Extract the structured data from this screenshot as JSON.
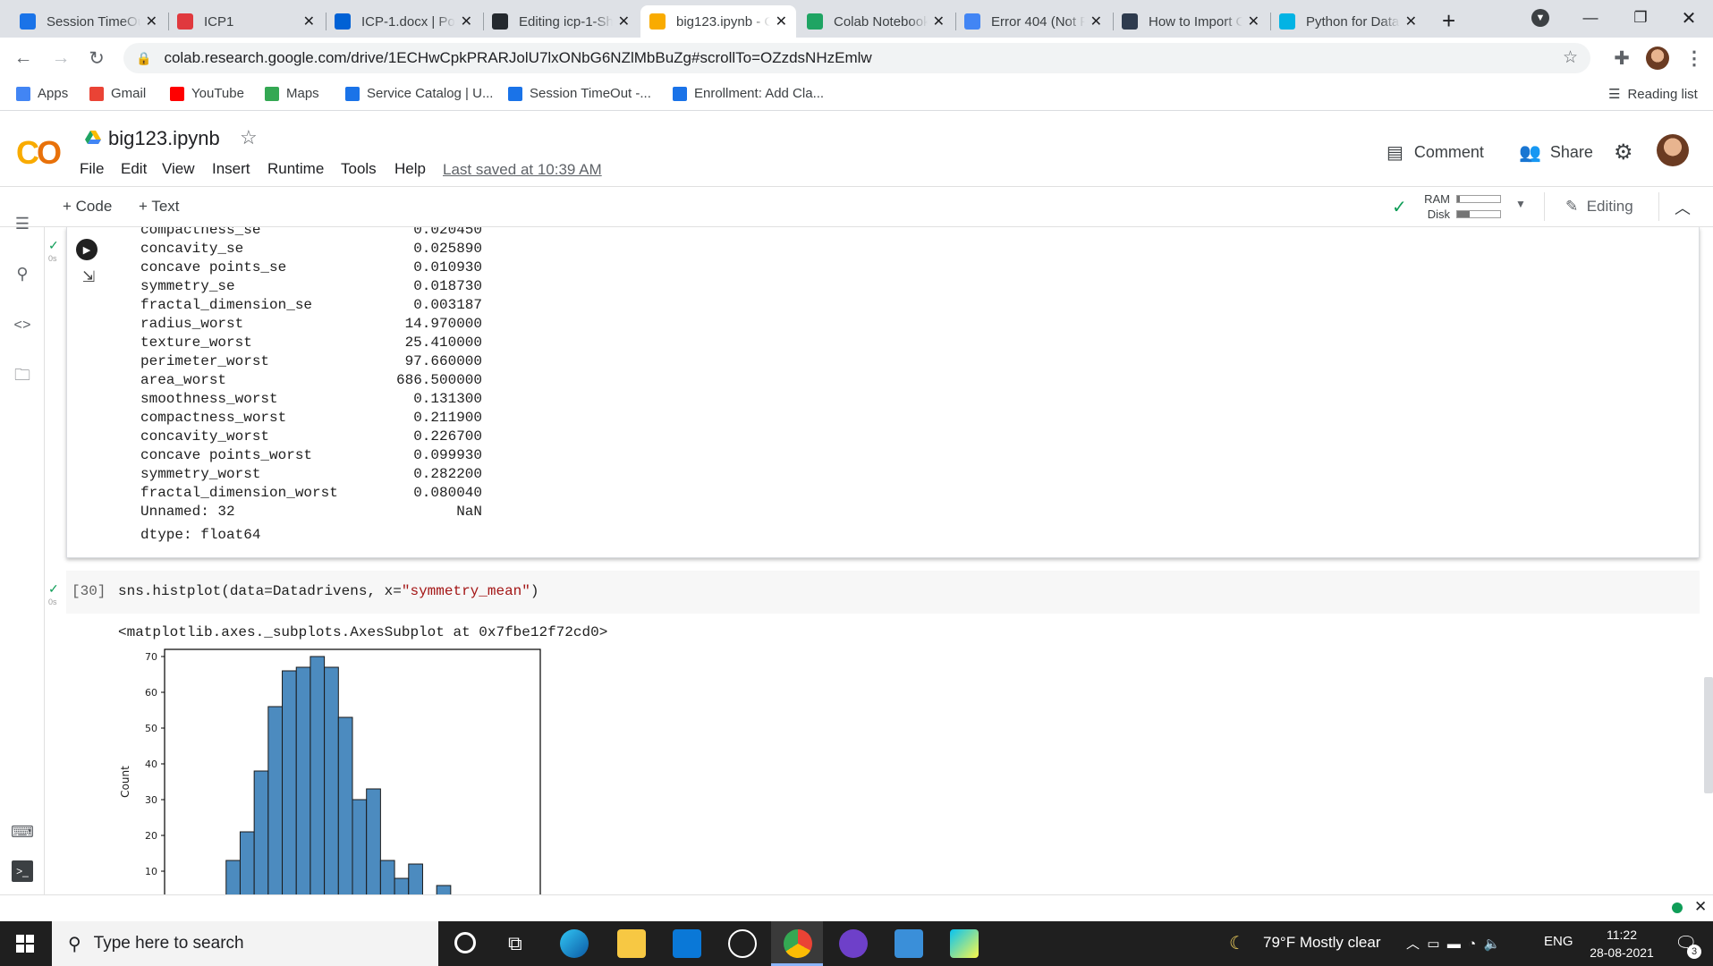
{
  "browser": {
    "tabs": [
      {
        "title": "Session TimeOut",
        "favicon": "salesforce-icon",
        "color": "#1a73e8"
      },
      {
        "title": "ICP1",
        "favicon": "canvas-icon",
        "color": "#e0393e"
      },
      {
        "title": "ICP-1.docx | Powered by Box",
        "favicon": "box-icon",
        "color": "#0061d5"
      },
      {
        "title": "Editing icp-1-Sheet",
        "favicon": "github-icon",
        "color": "#24292e"
      },
      {
        "title": "big123.ipynb - Colaboratory",
        "favicon": "colab-icon",
        "color": "#f9ab00"
      },
      {
        "title": "Colab Notebooks",
        "favicon": "drive-icon",
        "color": "#1fa463"
      },
      {
        "title": "Error 404 (Not Found)",
        "favicon": "google-icon",
        "color": "#4285f4"
      },
      {
        "title": "How to Import CSV",
        "favicon": "tds-icon",
        "color": "#2e3b4e"
      },
      {
        "title": "Python for Data Science",
        "favicon": "udacity-icon",
        "color": "#02b3e4"
      }
    ],
    "close_glyph": "✕",
    "new_tab_glyph": "+",
    "url": "colab.research.google.com/drive/1ECHwCpkPRARJolU7lxONbG6NZlMbBuZg#scrollTo=OZzdsNHzEmlw",
    "bookmarks": [
      {
        "label": "Apps",
        "icon": "apps-grid-icon",
        "color": "#4285f4"
      },
      {
        "label": "Gmail",
        "icon": "gmail-icon",
        "color": "#ea4335"
      },
      {
        "label": "YouTube",
        "icon": "youtube-icon",
        "color": "#ff0000"
      },
      {
        "label": "Maps",
        "icon": "maps-icon",
        "color": "#34a853"
      },
      {
        "label": "Service Catalog | U...",
        "icon": "service-icon",
        "color": "#1a73e8"
      },
      {
        "label": "Session TimeOut -...",
        "icon": "salesforce-icon",
        "color": "#1a73e8"
      },
      {
        "label": "Enrollment: Add Cla...",
        "icon": "salesforce-icon",
        "color": "#1a73e8"
      }
    ],
    "reading_list": "Reading list"
  },
  "colab": {
    "notebook_name": "big123.ipynb",
    "menu": [
      "File",
      "Edit",
      "View",
      "Insert",
      "Runtime",
      "Tools",
      "Help"
    ],
    "last_saved": "Last saved at 10:39 AM",
    "comment": "Comment",
    "share": "Share",
    "add_code": "+ Code",
    "add_text": "+ Text",
    "ram": "RAM",
    "disk": "Disk",
    "ram_fill": 0.06,
    "disk_fill": 0.3,
    "editing": "Editing",
    "accent": "#f9ab00"
  },
  "output_cell": {
    "exec_time": "0s",
    "rows": [
      {
        "key": "compactness_se",
        "value": "0.020450"
      },
      {
        "key": "concavity_se",
        "value": "0.025890"
      },
      {
        "key": "concave points_se",
        "value": "0.010930"
      },
      {
        "key": "symmetry_se",
        "value": "0.018730"
      },
      {
        "key": "fractal_dimension_se",
        "value": "0.003187"
      },
      {
        "key": "radius_worst",
        "value": "14.970000"
      },
      {
        "key": "texture_worst",
        "value": "25.410000"
      },
      {
        "key": "perimeter_worst",
        "value": "97.660000"
      },
      {
        "key": "area_worst",
        "value": "686.500000"
      },
      {
        "key": "smoothness_worst",
        "value": "0.131300"
      },
      {
        "key": "compactness_worst",
        "value": "0.211900"
      },
      {
        "key": "concavity_worst",
        "value": "0.226700"
      },
      {
        "key": "concave points_worst",
        "value": "0.099930"
      },
      {
        "key": "symmetry_worst",
        "value": "0.282200"
      },
      {
        "key": "fractal_dimension_worst",
        "value": "0.080040"
      },
      {
        "key": "Unnamed: 32",
        "value": "NaN"
      }
    ],
    "dtype": "dtype: float64"
  },
  "code_cell": {
    "exec_count": "[30]",
    "exec_time": "0s",
    "code_prefix": "sns.histplot(data=Datadrivens, x=",
    "code_string": "\"symmetry_mean\"",
    "code_suffix": ")",
    "result_text": "<matplotlib.axes._subplots.AxesSubplot at 0x7fbe12f72cd0>"
  },
  "chart_data": {
    "type": "bar",
    "title": "",
    "xlabel": "",
    "ylabel": "Count",
    "ylim": [
      0,
      72
    ],
    "yticks": [
      0,
      10,
      20,
      30,
      40,
      50,
      60,
      70
    ],
    "values": [
      0,
      1,
      3,
      2,
      13,
      21,
      38,
      56,
      66,
      67,
      70,
      67,
      53,
      30,
      33,
      13,
      8,
      12,
      2,
      6,
      3,
      2,
      1,
      0,
      1,
      1
    ],
    "bar_color": "#4c8bbf",
    "grid": false
  },
  "taskbar": {
    "search_placeholder": "Type here to search",
    "weather": "79°F  Mostly clear",
    "lang": "ENG",
    "time": "11:22",
    "date": "28-08-2021",
    "notifications": "3"
  }
}
